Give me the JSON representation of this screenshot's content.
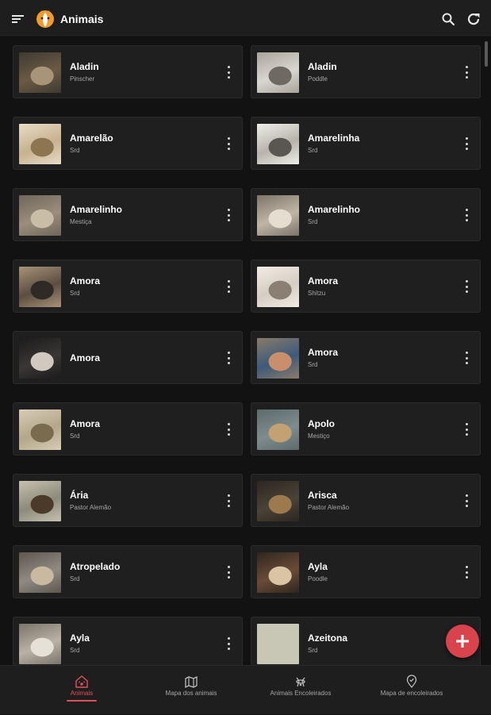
{
  "app": {
    "title": "Animais",
    "accent": "#e0505a",
    "fab_color": "#d9434c",
    "icons": {
      "menu": "menu-icon",
      "logo": "cat-dog-logo",
      "search": "search-icon",
      "refresh": "refresh-icon",
      "fab": "plus-icon",
      "more": "more-vert-icon"
    }
  },
  "animals": [
    {
      "name": "Aladin",
      "breed": "Pinscher",
      "photo": "dog-photo"
    },
    {
      "name": "Aladin",
      "breed": "Poddle",
      "photo": "dog-photo"
    },
    {
      "name": "Amarelão",
      "breed": "Srd",
      "photo": "dog-photo"
    },
    {
      "name": "Amarelinha",
      "breed": "Srd",
      "photo": "dog-photo"
    },
    {
      "name": "Amarelinho",
      "breed": "Mestiça",
      "photo": "dog-photo"
    },
    {
      "name": "Amarelinho",
      "breed": "Srd",
      "photo": "dog-photo"
    },
    {
      "name": "Amora",
      "breed": "Srd",
      "photo": "dog-photo"
    },
    {
      "name": "Amora",
      "breed": "Shitzu",
      "photo": "dog-photo"
    },
    {
      "name": "Amora",
      "breed": "",
      "photo": "cat-photo"
    },
    {
      "name": "Amora",
      "breed": "Srd",
      "photo": "dog-photo"
    },
    {
      "name": "Amora",
      "breed": "Srd",
      "photo": "dog-photo"
    },
    {
      "name": "Apolo",
      "breed": "Mestiço",
      "photo": "dog-photo"
    },
    {
      "name": "Ária",
      "breed": "Pastor Alemão",
      "photo": "dog-photo"
    },
    {
      "name": "Arisca",
      "breed": "Pastor Alemão",
      "photo": "dog-photo"
    },
    {
      "name": "Atropelado",
      "breed": "Srd",
      "photo": "dog-photo"
    },
    {
      "name": "Ayla",
      "breed": "Poodle",
      "photo": "dog-photo"
    },
    {
      "name": "Ayla",
      "breed": "Srd",
      "photo": "dog-photo"
    },
    {
      "name": "Azeitona",
      "breed": "Srd",
      "photo": "placeholder-photo"
    }
  ],
  "bottom_nav": [
    {
      "label": "Animais",
      "icon": "paw-house-icon",
      "active": true
    },
    {
      "label": "Mapa dos animais",
      "icon": "map-icon",
      "active": false
    },
    {
      "label": "Animais Encoleirados",
      "icon": "collar-icon",
      "active": false
    },
    {
      "label": "Mapa de encoleirados",
      "icon": "location-pin-icon",
      "active": false
    }
  ]
}
